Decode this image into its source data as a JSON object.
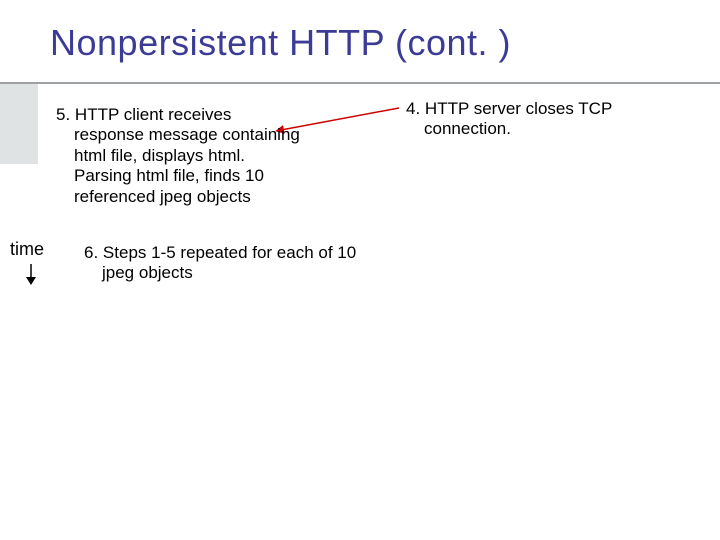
{
  "title": "Nonpersistent HTTP (cont. )",
  "time_label": "time",
  "steps": {
    "s4": {
      "num": "4.",
      "text": "HTTP server closes TCP connection."
    },
    "s5": {
      "num": "5.",
      "text": "HTTP client receives response message containing html file, displays html.  Parsing html file, finds 10 referenced jpeg  objects"
    },
    "s6": {
      "num": "6.",
      "text": "Steps 1-5 repeated for each of 10 jpeg objects"
    }
  },
  "colors": {
    "title": "#3C3C96",
    "arrow": "#cc0000",
    "sidebar": "#e0e3e4"
  }
}
